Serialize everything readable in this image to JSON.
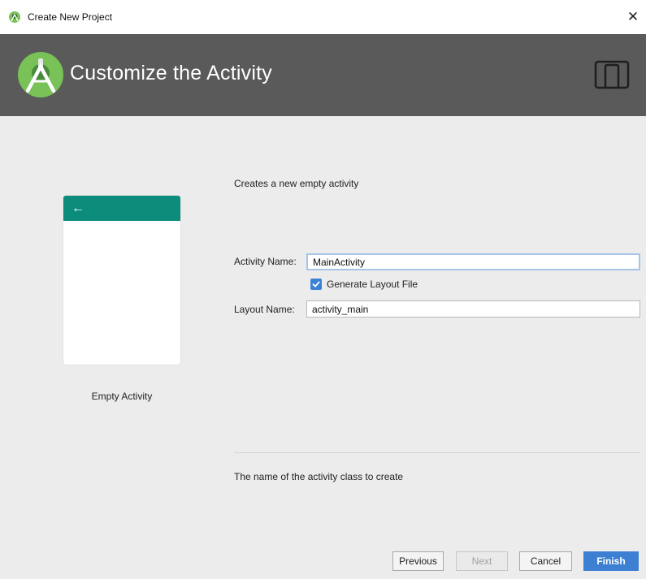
{
  "window": {
    "title": "Create New Project",
    "close_glyph": "✕",
    "app_icon": "android-studio-icon"
  },
  "header": {
    "heading": "Customize the Activity",
    "logo_icon": "android-studio-logo-icon",
    "device_icon": "device-tablet-phone-icon",
    "background": "#5a5a5a"
  },
  "preview": {
    "back_glyph": "←",
    "caption": "Empty Activity",
    "appbar_color": "#0c8d7c"
  },
  "form": {
    "description": "Creates a new empty activity",
    "activity_name_label": "Activity Name:",
    "activity_name_value": "MainActivity",
    "generate_layout_label": "Generate Layout File",
    "generate_layout_checked": true,
    "layout_name_label": "Layout Name:",
    "layout_name_value": "activity_main"
  },
  "hint": "The name of the activity class to create",
  "buttons": {
    "previous": "Previous",
    "next": "Next",
    "cancel": "Cancel",
    "finish": "Finish",
    "next_disabled": true
  },
  "colors": {
    "accent": "#3d7fd3",
    "checkbox": "#3b82d6"
  }
}
